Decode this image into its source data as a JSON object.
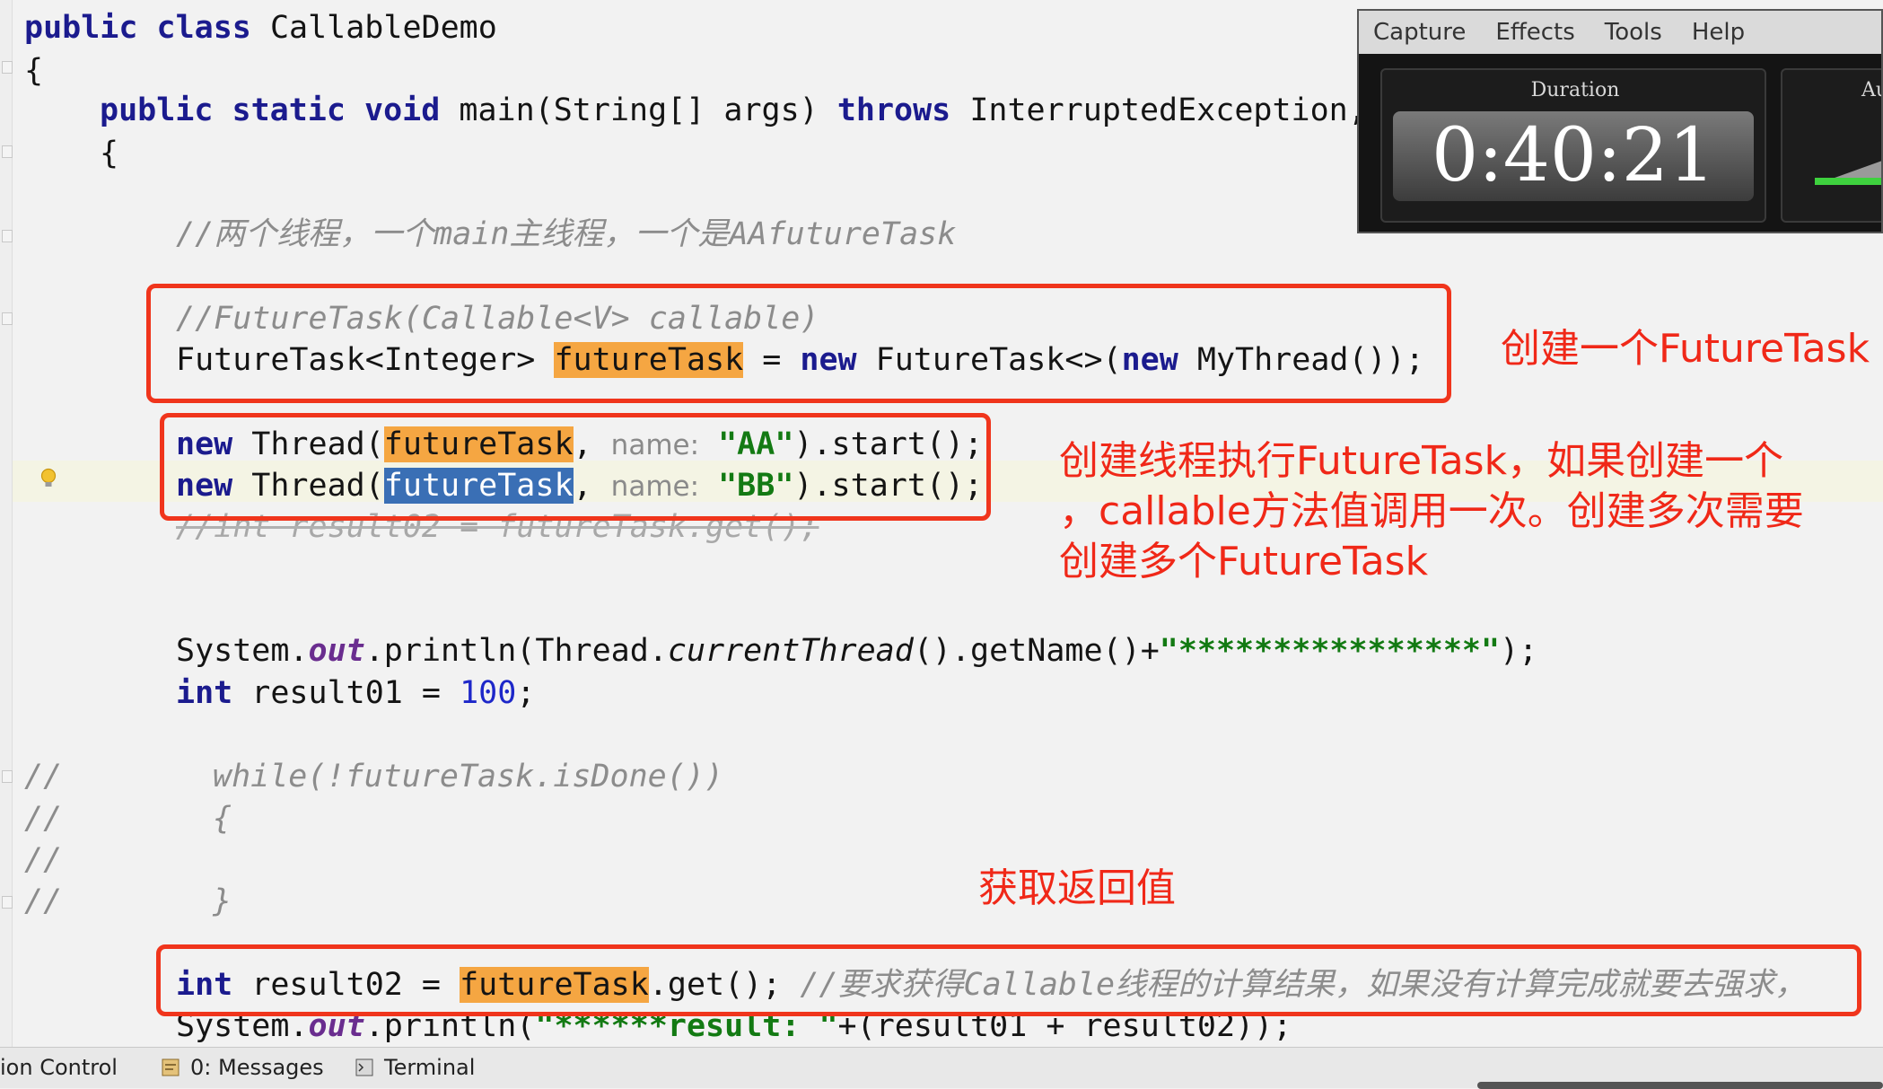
{
  "code": {
    "l1_kw": "public class",
    "l1_name": " CallableDemo",
    "l2": "{",
    "l3_kw": "public static void",
    "l3_main": " main(String[] args) ",
    "l3_throws": "throws",
    "l3_exc": " InterruptedException,",
    "l4": "{",
    "l5_comment": "//两个线程，一个main主线程，一个是AAfutureTask",
    "l6_comment": "//FutureTask(Callable<V> callable)",
    "l7_type": "FutureTask<Integer> ",
    "l7_var": "futureTask",
    "l7_eq": " = ",
    "l7_new": "new",
    "l7_ctor": " FutureTask<>(",
    "l7_new2": "new",
    "l7_end": " MyThread());",
    "l8_new": "new",
    "l8_thread": " Thread(",
    "l8_var": "futureTask",
    "l8_comma": ", ",
    "l8_hint": "name:",
    "l8_sp": " ",
    "l8_str": "\"AA\"",
    "l8_end": ").start();",
    "l9_new": "new",
    "l9_thread": " Thread(",
    "l9_var": "futureTask",
    "l9_comma": ", ",
    "l9_hint": "name:",
    "l9_sp": " ",
    "l9_str": "\"BB\"",
    "l9_end": ").start();",
    "l10_comment": "//int result02 = futureTask.get();",
    "l11_a": "System.",
    "l11_out": "out",
    "l11_b": ".println(Thread.",
    "l11_ct": "currentThread",
    "l11_c": "().getName()+",
    "l11_str": "\"****************\"",
    "l11_d": ");",
    "l12_kw": "int",
    "l12_mid": " result01 = ",
    "l12_num": "100",
    "l12_end": ";",
    "l13_prefix": "//",
    "l13_body": "while(!futureTask.isDone())",
    "l14_prefix": "//",
    "l14_body": "{",
    "l15_prefix": "//",
    "l16_prefix": "//",
    "l16_body": "}",
    "l17_kw": "int",
    "l17_mid": " result02 = ",
    "l17_var": "futureTask",
    "l17_end": ".get(); ",
    "l17_comment": "//要求获得Callable线程的计算结果，如果没有计算完成就要去强求，",
    "l18_a": "System.",
    "l18_out": "out",
    "l18_b": ".println(",
    "l18_str": "\"******result: \"",
    "l18_c": "+(result01 + result02));"
  },
  "annotations": {
    "a1": "创建一个FutureTask",
    "a2_line1": "创建线程执行FutureTask，如果创建一个",
    "a2_line2": "，callable方法值调用一次。创建多次需要",
    "a2_line3": "创建多个FutureTask",
    "a3": "获取返回值"
  },
  "capture_app": {
    "menu": [
      "Capture",
      "Effects",
      "Tools",
      "Help"
    ],
    "duration_label": "Duration",
    "duration_value": "0:40:21",
    "audio_label": "Au"
  },
  "statusbar": {
    "version_control": "ion Control",
    "messages": "0: Messages",
    "terminal": "Terminal"
  },
  "colors": {
    "annotation_red": "#f02818",
    "keyword": "#1b1b8e",
    "string": "#137a13",
    "highlight": "#f5a642",
    "selection": "#3a6fb5"
  }
}
